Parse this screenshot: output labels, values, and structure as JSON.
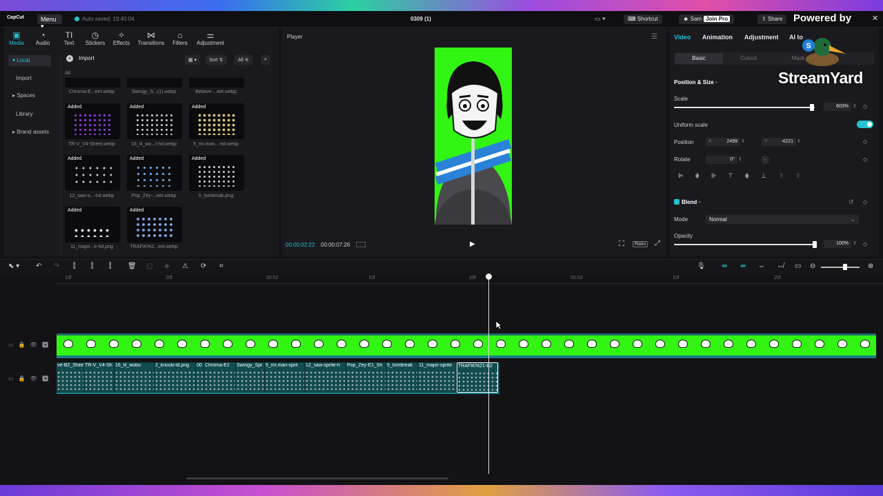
{
  "titlebar": {
    "app_logo": "CapCut",
    "menu_label": "Menu",
    "autosave": "Auto saved: 19:40:04",
    "project_title": "0309 (1)",
    "shortcut_label": "Shortcut",
    "user_name": "Sam",
    "join_pro_label": "Join Pro",
    "share_label": "Share"
  },
  "overlay": {
    "powered_by": "Powered by",
    "streamyard": "StreamYard"
  },
  "media": {
    "tabs": [
      {
        "label": "Media",
        "icon": "media-icon"
      },
      {
        "label": "Audio",
        "icon": "audio-icon"
      },
      {
        "label": "Text",
        "icon": "text-icon"
      },
      {
        "label": "Stickers",
        "icon": "stickers-icon"
      },
      {
        "label": "Effects",
        "icon": "effects-icon"
      },
      {
        "label": "Transitions",
        "icon": "transitions-icon"
      },
      {
        "label": "Filters",
        "icon": "filters-icon"
      },
      {
        "label": "Adjustment",
        "icon": "adjustment-icon"
      }
    ],
    "sidebar": [
      "Local",
      "Import",
      "Spaces",
      "Library",
      "Brand assets"
    ],
    "import_label": "Import",
    "sort_label": "Sort",
    "all_label": "All",
    "all_section": "All",
    "added_badge": "Added",
    "top_row_labels": [
      "Chroma-E...eet.webp",
      "Swingy_S...(1).webp",
      "Believe-...eet.webp"
    ],
    "items": [
      {
        "label": "TR-V_V4-Sheet.webp",
        "color": "#8a3cd8"
      },
      {
        "label": "16_lil_wo...t-hd.webp",
        "color": "#c8c8cc"
      },
      {
        "label": "5_mr.man...-hd.webp",
        "color": "#d8c27a"
      },
      {
        "label": "12_saw-s...-hd.webp",
        "color": "#c8c8cc"
      },
      {
        "label": "Pop_Zey-...eet.webp",
        "color": "#6aa0e0"
      },
      {
        "label": "5_tombmak.png",
        "color": "#c8c8cc"
      },
      {
        "label": "11_major...e-hd.png",
        "color": "#e6e6e6"
      },
      {
        "label": "TRAFIK%2...eet.webp",
        "color": "#7fa8e8"
      }
    ]
  },
  "player": {
    "title": "Player",
    "time_current": "00:00:02:22",
    "time_total": "00:00:07:26",
    "ratio_label": "Ratio"
  },
  "properties": {
    "tabs": [
      "Video",
      "Animation",
      "Adjustment",
      "AI to"
    ],
    "subtabs": [
      "Basic",
      "Cutout",
      "Mask"
    ],
    "position_size_label": "Position & Size",
    "scale_label": "Scale",
    "scale_value": "603%",
    "scale_fraction": 0.98,
    "uniform_scale_label": "Uniform scale",
    "position_label": "Position",
    "x_label": "X",
    "x_value": "2499",
    "y_label": "Y",
    "y_value": "-4221",
    "rotate_label": "Rotate",
    "rotate_value": "0°",
    "blend_label": "Blend",
    "mode_label": "Mode",
    "mode_value": "Normal",
    "opacity_label": "Opacity",
    "opacity_value": "100%",
    "opacity_fraction": 1.0
  },
  "timeline": {
    "ruler_labels": [
      "10f",
      "20f",
      "00:02",
      "10f",
      "20f",
      "00:03",
      "10f",
      "20f"
    ],
    "clips": [
      "ve-B2_Shee",
      "TR-V_V4-Sh",
      "16_lil_wobo",
      "2_knocki-ld.png",
      "00",
      "Chroma-E1",
      "Swingy_Spr",
      "5_mr.man-sprit",
      "12_saw-sprite-h",
      "Pop_Zey-E1_Sh",
      "5_tombreak",
      "11_major-sprite",
      "TRAFIK%21-B2"
    ]
  },
  "colors": {
    "accent": "#25c2d3",
    "green_screen": "#32f514"
  }
}
